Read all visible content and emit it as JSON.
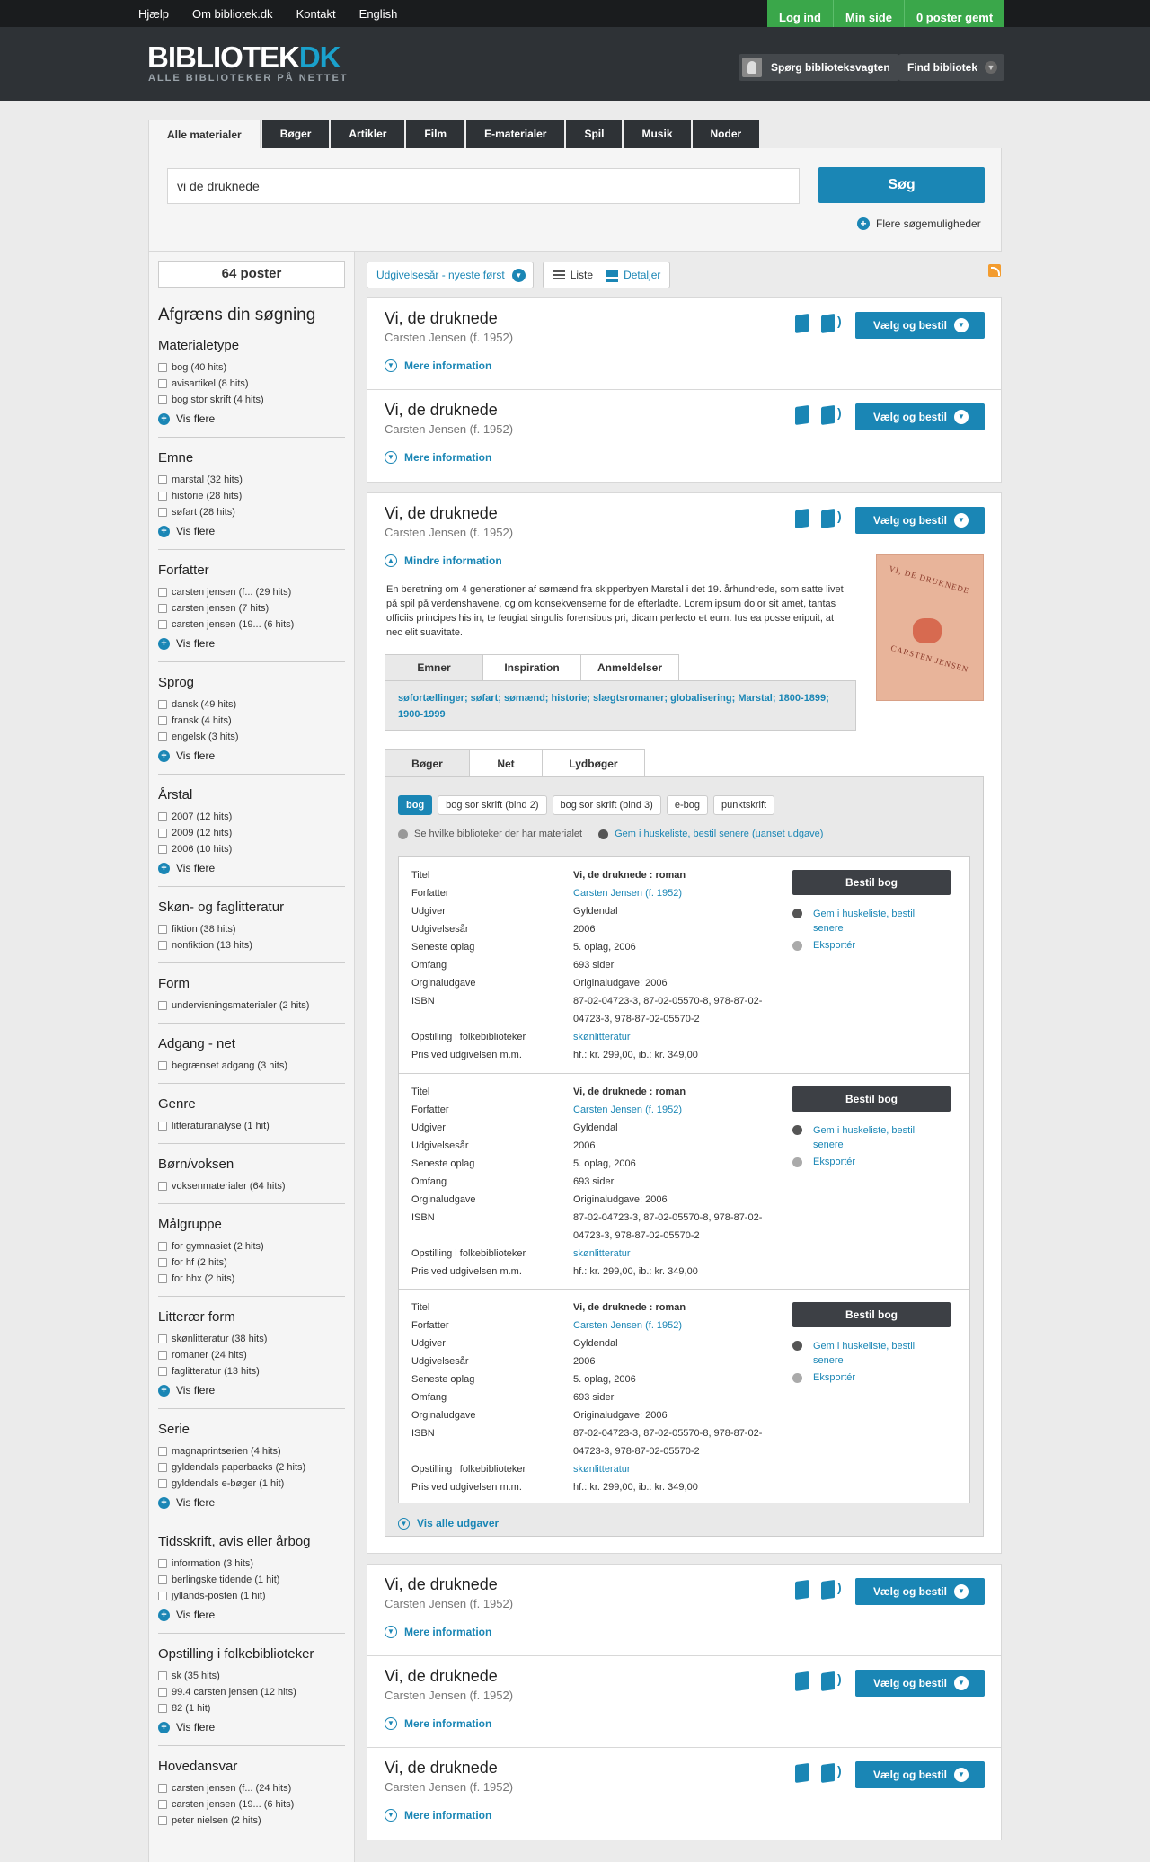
{
  "top_nav": {
    "links": [
      "Hjælp",
      "Om bibliotek.dk",
      "Kontakt",
      "English"
    ]
  },
  "user_nav": {
    "login": "Log ind",
    "my_page": "Min side",
    "saved": "0 poster gemt"
  },
  "header": {
    "logo_main": "BIBLIOTEK",
    "logo_accent": "DK",
    "tagline": "ALLE BIBLIOTEKER PÅ NETTET",
    "ask_button": "Spørg biblioteksvagten",
    "find_button": "Find bibliotek"
  },
  "search": {
    "tabs": [
      "Alle materialer",
      "Bøger",
      "Artikler",
      "Film",
      "E-materialer",
      "Spil",
      "Musik",
      "Noder"
    ],
    "query": "vi de druknede",
    "button": "Søg",
    "more_options": "Flere søgemuligheder"
  },
  "sidebar": {
    "post_count": "64 poster",
    "heading": "Afgræns din søgning",
    "facets": [
      {
        "title": "Materialetype",
        "items": [
          "bog (40 hits)",
          "avisartikel (8 hits)",
          "bog stor skrift (4 hits)"
        ],
        "more": "Vis flere"
      },
      {
        "title": "Emne",
        "items": [
          "marstal (32 hits)",
          "historie (28 hits)",
          "søfart (28 hits)"
        ],
        "more": "Vis flere"
      },
      {
        "title": "Forfatter",
        "items": [
          "carsten jensen (f... (29 hits)",
          "carsten jensen (7 hits)",
          "carsten jensen (19... (6 hits)"
        ],
        "more": "Vis flere"
      },
      {
        "title": "Sprog",
        "items": [
          "dansk (49 hits)",
          "fransk (4 hits)",
          "engelsk (3 hits)"
        ],
        "more": "Vis flere"
      },
      {
        "title": "Årstal",
        "items": [
          "2007 (12 hits)",
          "2009 (12 hits)",
          "2006 (10 hits)"
        ],
        "more": "Vis flere"
      },
      {
        "title": "Skøn- og faglitteratur",
        "items": [
          "fiktion (38 hits)",
          "nonfiktion (13 hits)"
        ],
        "more": ""
      },
      {
        "title": "Form",
        "items": [
          "undervisningsmaterialer (2 hits)"
        ],
        "more": ""
      },
      {
        "title": "Adgang - net",
        "items": [
          "begrænset adgang (3 hits)"
        ],
        "more": ""
      },
      {
        "title": "Genre",
        "items": [
          "litteraturanalyse (1 hit)"
        ],
        "more": ""
      },
      {
        "title": "Børn/voksen",
        "items": [
          "voksenmaterialer (64 hits)"
        ],
        "more": ""
      },
      {
        "title": "Målgruppe",
        "items": [
          "for gymnasiet (2 hits)",
          "for hf (2 hits)",
          "for hhx (2 hits)"
        ],
        "more": ""
      },
      {
        "title": "Litterær form",
        "items": [
          "skønlitteratur (38 hits)",
          "romaner (24 hits)",
          "faglitteratur (13 hits)"
        ],
        "more": "Vis flere"
      },
      {
        "title": "Serie",
        "items": [
          "magnaprintserien (4 hits)",
          "gyldendals paperbacks (2 hits)",
          "gyldendals e-bøger (1 hit)"
        ],
        "more": "Vis flere"
      },
      {
        "title": "Tidsskrift, avis eller årbog",
        "items": [
          "information (3 hits)",
          "berlingske tidende (1 hit)",
          "jyllands-posten (1 hit)"
        ],
        "more": "Vis flere"
      },
      {
        "title": "Opstilling i folkebiblioteker",
        "items": [
          "sk (35 hits)",
          "99.4 carsten jensen (12 hits)",
          "82 (1 hit)"
        ],
        "more": "Vis flere"
      },
      {
        "title": "Hovedansvar",
        "items": [
          "carsten jensen (f... (24 hits)",
          "carsten jensen (19... (6 hits)",
          "peter nielsen (2 hits)"
        ],
        "more": ""
      }
    ]
  },
  "controls": {
    "sort": "Udgivelsesår - nyeste først",
    "view_list": "Liste",
    "view_details": "Detaljer"
  },
  "results": [
    {
      "title": "Vi, de druknede",
      "author": "Carsten Jensen (f. 1952)",
      "more": "Mere information",
      "button": "Vælg og bestil"
    },
    {
      "title": "Vi, de druknede",
      "author": "Carsten Jensen (f. 1952)",
      "more": "Mere information",
      "button": "Vælg og bestil"
    },
    {
      "title": "Vi, de druknede",
      "author": "Carsten Jensen (f. 1952)",
      "more": "Mindre information",
      "button": "Vælg og bestil"
    },
    {
      "title": "Vi, de druknede",
      "author": "Carsten Jensen (f. 1952)",
      "more": "Mere information",
      "button": "Vælg og bestil"
    },
    {
      "title": "Vi, de druknede",
      "author": "Carsten Jensen (f. 1952)",
      "more": "Mere information",
      "button": "Vælg og bestil"
    },
    {
      "title": "Vi, de druknede",
      "author": "Carsten Jensen (f. 1952)",
      "more": "Mere information",
      "button": "Vælg og bestil"
    }
  ],
  "expanded": {
    "description": "En beretning om 4 generationer af sømænd fra skipperbyen Marstal i det 19. århundrede, som satte livet på spil på verdenshavene, og om konsekvenserne for de efterladte. Lorem ipsum dolor sit amet, tantas officiis principes his in, te feugiat singulis forensibus pri, dicam perfecto et eum. Ius ea posse eripuit, at nec elit suavitate.",
    "cover_title": "VI, DE DRUKNEDE",
    "cover_author": "CARSTEN JENSEN",
    "subject_tabs": [
      "Emner",
      "Inspiration",
      "Anmeldelser"
    ],
    "subjects": "søfortællinger; søfart; sømænd; historie; slægtsromaner; globalisering; Marstal; 1800-1899; 1900-1999",
    "edition_tabs": [
      "Bøger",
      "Net",
      "Lydbøger"
    ],
    "formats": [
      "bog",
      "bog sor skrift (bind 2)",
      "bog sor skrift (bind 3)",
      "e-bog",
      "punktskrift"
    ],
    "libraries_link": "Se hvilke biblioteker der har materialet",
    "save_link": "Gem i huskeliste, bestil senere (uanset udgave)",
    "labels": [
      "Titel",
      "Forfatter",
      "Udgiver",
      "Udgivelsesår",
      "Seneste oplag",
      "Omfang",
      "Orginaludgave",
      "ISBN",
      "Opstilling i folkebiblioteker",
      "Pris ved udgivelsen m.m."
    ],
    "editions": [
      {
        "titel": "Vi, de druknede : roman",
        "forfatter": "Carsten Jensen (f. 1952)",
        "udgiver": "Gyldendal",
        "aar": "2006",
        "oplag": "5. oplag, 2006",
        "omfang": "693 sider",
        "orig": "Originaludgave: 2006",
        "isbn": "87-02-04723-3, 87-02-05570-8, 978-87-02-04723-3, 978-87-02-05570-2",
        "opst": "skønlitteratur",
        "pris": "hf.: kr. 299,00, ib.: kr. 349,00",
        "order": "Bestil bog",
        "gem": "Gem i huskeliste, bestil senere",
        "export": "Eksportér"
      },
      {
        "titel": "Vi, de druknede : roman",
        "forfatter": "Carsten Jensen (f. 1952)",
        "udgiver": "Gyldendal",
        "aar": "2006",
        "oplag": "5. oplag, 2006",
        "omfang": "693 sider",
        "orig": "Originaludgave: 2006",
        "isbn": "87-02-04723-3, 87-02-05570-8, 978-87-02-04723-3, 978-87-02-05570-2",
        "opst": "skønlitteratur",
        "pris": "hf.: kr. 299,00, ib.: kr. 349,00",
        "order": "Bestil bog",
        "gem": "Gem i huskeliste, bestil senere",
        "export": "Eksportér"
      },
      {
        "titel": "Vi, de druknede : roman",
        "forfatter": "Carsten Jensen (f. 1952)",
        "udgiver": "Gyldendal",
        "aar": "2006",
        "oplag": "5. oplag, 2006",
        "omfang": "693 sider",
        "orig": "Originaludgave: 2006",
        "isbn": "87-02-04723-3, 87-02-05570-8, 978-87-02-04723-3, 978-87-02-05570-2",
        "opst": "skønlitteratur",
        "pris": "hf.: kr. 299,00, ib.: kr. 349,00",
        "order": "Bestil bog",
        "gem": "Gem i huskeliste, bestil senere",
        "export": "Eksportér"
      }
    ],
    "all_editions": "Vis alle udgaver"
  }
}
